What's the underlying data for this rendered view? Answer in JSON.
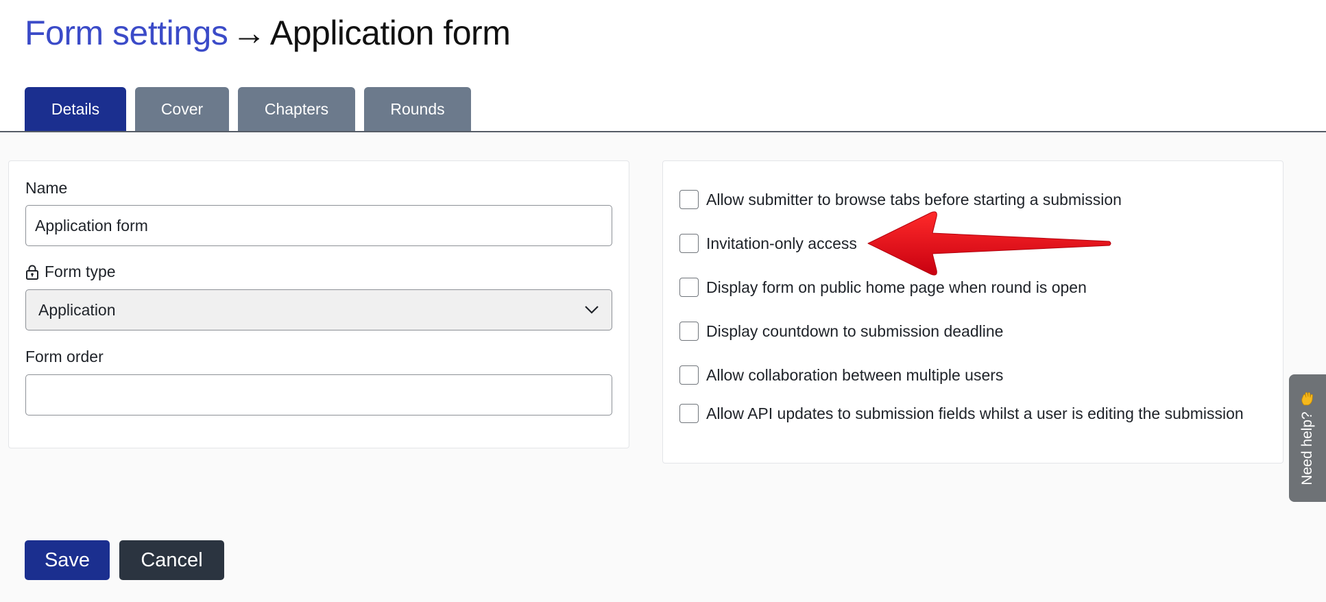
{
  "header": {
    "breadcrumb": "Form settings",
    "arrow": "→",
    "title": "Application form"
  },
  "tabs": [
    {
      "label": "Details",
      "active": true
    },
    {
      "label": "Cover",
      "active": false
    },
    {
      "label": "Chapters",
      "active": false
    },
    {
      "label": "Rounds",
      "active": false
    }
  ],
  "details": {
    "name_label": "Name",
    "name_value": "Application form",
    "form_type_label": "Form type",
    "form_type_value": "Application",
    "form_order_label": "Form order",
    "form_order_value": ""
  },
  "options": [
    {
      "label": "Allow submitter to browse tabs before starting a submission",
      "checked": false
    },
    {
      "label": "Invitation-only access",
      "checked": false
    },
    {
      "label": "Display form on public home page when round is open",
      "checked": false
    },
    {
      "label": "Display countdown to submission deadline",
      "checked": false
    },
    {
      "label": "Allow collaboration between multiple users",
      "checked": false
    },
    {
      "label": "Allow API updates to submission fields whilst a user is editing the submission",
      "checked": false
    }
  ],
  "help": {
    "label": "Need help?",
    "icon": "waving-hand-icon"
  },
  "footer": {
    "save_label": "Save",
    "cancel_label": "Cancel"
  },
  "colors": {
    "primary": "#1b2f8f",
    "tab_inactive": "#6c7a8c",
    "breadcrumb": "#3b4bc8",
    "annotation_arrow": "#e30613",
    "cancel": "#2b3440"
  }
}
